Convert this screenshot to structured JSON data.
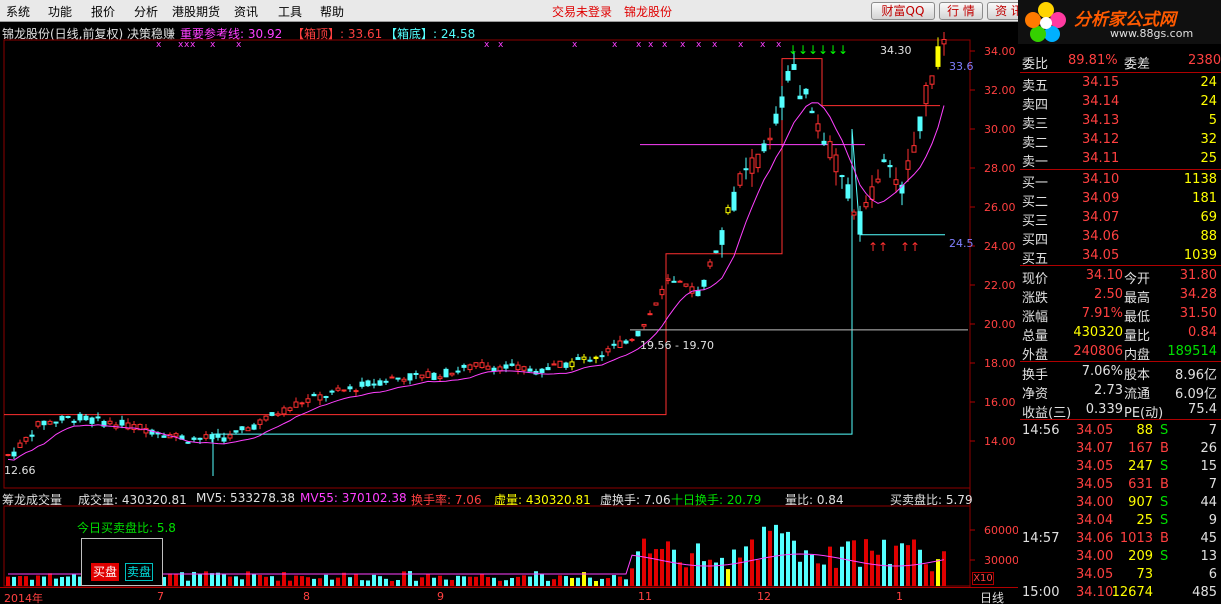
{
  "menu": [
    "系统",
    "功能",
    "报价",
    "分析",
    "港股期货",
    "资讯",
    "工具",
    "帮助"
  ],
  "status": {
    "login": "交易未登录",
    "stock": "锦龙股份"
  },
  "top_buttons": [
    "财富QQ",
    "行 情",
    "资 讯"
  ],
  "logo": {
    "text": "分析家公式网",
    "url": "www.88gs.com"
  },
  "header": {
    "title": "锦龙股份(日线,前复权) 决策稳赚",
    "ref_line_label": "重要参考线: 30.92",
    "box_top_label": "【箱顶】: 33.61",
    "box_bottom_label": "【箱底】: 24.58"
  },
  "price_axis": [
    "34.00",
    "32.00",
    "30.00",
    "28.00",
    "26.00",
    "24.00",
    "22.00",
    "20.00",
    "18.00",
    "16.00",
    "14.00"
  ],
  "annotations": {
    "range_label": "19.56 - 19.70",
    "high_label": "34.30",
    "low_label": "12.66",
    "box_top_tag": "33.6",
    "box_bottom_tag": "24.5"
  },
  "volume_header": {
    "name": "筹龙成交量",
    "vol": "成交量: 430320.81",
    "mv5": "MV5: 533278.38",
    "mv55": "MV55: 370102.38",
    "turnover": "换手率: 7.06",
    "virtual_vol": "虚量: 430320.81",
    "virtual_turn": "虚换手: 7.06",
    "ten_day_turn": "十日换手: 20.79",
    "vol_ratio": "量比: 0.84",
    "buy_sell_ratio": "买卖盘比: 5.79"
  },
  "volume_axis": [
    "60000",
    "30000"
  ],
  "buy_sell_today": "今日买卖盘比: 5.8",
  "buy_label": "买盘",
  "sell_label": "卖盘",
  "x10": "X10",
  "period": "日线",
  "date_axis": [
    "2014年",
    "7",
    "8",
    "9",
    "11",
    "12",
    "1"
  ],
  "quote": {
    "ratio": {
      "l1": "委比",
      "v1": "89.81%",
      "l2": "委差",
      "v2": "2380"
    },
    "asks": [
      {
        "label": "卖五",
        "price": "34.15",
        "vol": "24"
      },
      {
        "label": "卖四",
        "price": "34.14",
        "vol": "24"
      },
      {
        "label": "卖三",
        "price": "34.13",
        "vol": "5"
      },
      {
        "label": "卖二",
        "price": "34.12",
        "vol": "32"
      },
      {
        "label": "卖一",
        "price": "34.11",
        "vol": "25"
      }
    ],
    "bids": [
      {
        "label": "买一",
        "price": "34.10",
        "vol": "1138"
      },
      {
        "label": "买二",
        "price": "34.09",
        "vol": "181"
      },
      {
        "label": "买三",
        "price": "34.07",
        "vol": "69"
      },
      {
        "label": "买四",
        "price": "34.06",
        "vol": "88"
      },
      {
        "label": "买五",
        "price": "34.05",
        "vol": "1039"
      }
    ],
    "stats": [
      {
        "l1": "现价",
        "v1": "34.10",
        "l2": "今开",
        "v2": "31.80"
      },
      {
        "l1": "涨跌",
        "v1": "2.50",
        "l2": "最高",
        "v2": "34.28"
      },
      {
        "l1": "涨幅",
        "v1": "7.91%",
        "l2": "最低",
        "v2": "31.50"
      },
      {
        "l1": "总量",
        "v1": "430320",
        "l2": "量比",
        "v2": "0.84"
      },
      {
        "l1": "外盘",
        "v1": "240806",
        "l2": "内盘",
        "v2": "189514"
      }
    ],
    "stats2": [
      {
        "l1": "换手",
        "v1": "7.06%",
        "l2": "股本",
        "v2": "8.96亿"
      },
      {
        "l1": "净资",
        "v1": "2.73",
        "l2": "流通",
        "v2": "6.09亿"
      },
      {
        "l1": "收益(三)",
        "v1": "0.339",
        "l2": "PE(动)",
        "v2": "75.4"
      }
    ],
    "ticks": [
      {
        "time": "14:56",
        "price": "34.05",
        "vol": "88",
        "side": "S",
        "num": "7"
      },
      {
        "time": "",
        "price": "34.07",
        "vol": "167",
        "side": "B",
        "num": "26"
      },
      {
        "time": "",
        "price": "34.05",
        "vol": "247",
        "side": "S",
        "num": "15"
      },
      {
        "time": "",
        "price": "34.05",
        "vol": "631",
        "side": "B",
        "num": "7"
      },
      {
        "time": "",
        "price": "34.00",
        "vol": "907",
        "side": "S",
        "num": "44"
      },
      {
        "time": "",
        "price": "34.04",
        "vol": "25",
        "side": "S",
        "num": "9"
      },
      {
        "time": "14:57",
        "price": "34.06",
        "vol": "1013",
        "side": "B",
        "num": "45"
      },
      {
        "time": "",
        "price": "34.00",
        "vol": "209",
        "side": "S",
        "num": "13"
      },
      {
        "time": "",
        "price": "34.05",
        "vol": "73",
        "side": "",
        "num": "6"
      },
      {
        "time": "15:00",
        "price": "34.10",
        "vol": "12674",
        "side": "",
        "num": "485"
      }
    ]
  },
  "colors": {
    "up": "#ff3030",
    "down": "#54ffff",
    "bg": "#000000",
    "grid": "#8b0000",
    "ma": "#ff40ff",
    "box": "#ff3030"
  }
}
